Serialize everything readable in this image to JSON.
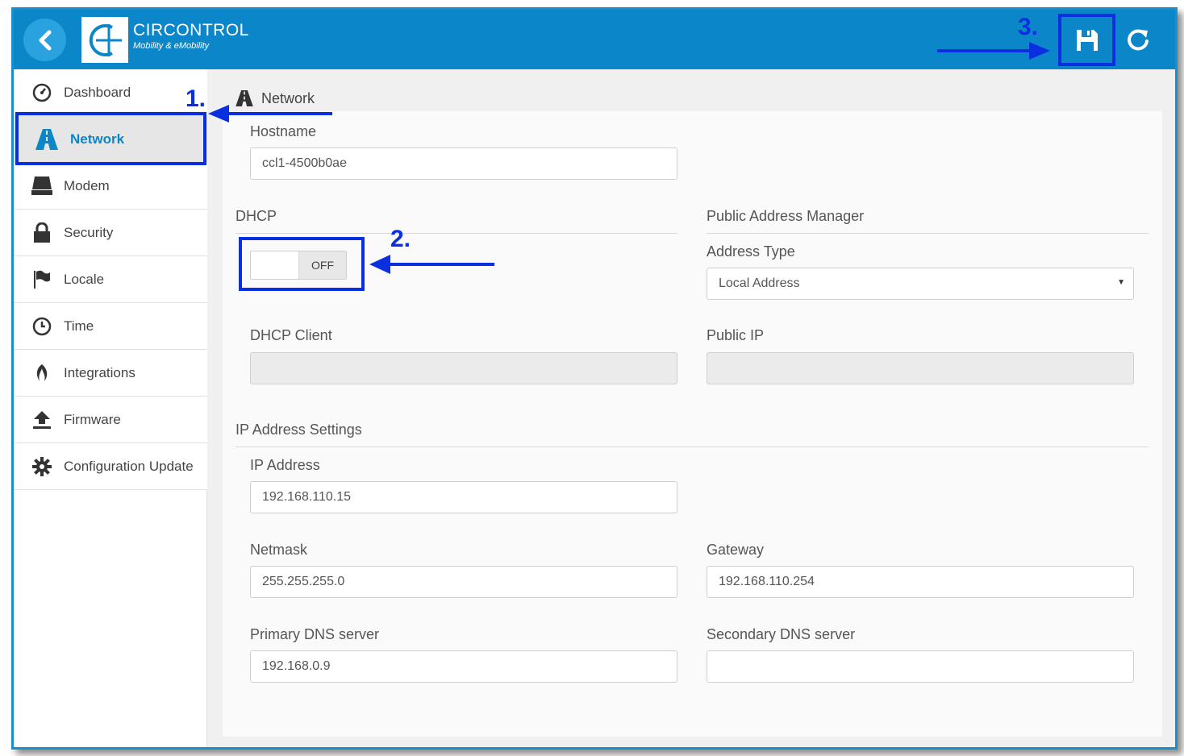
{
  "app": {
    "brand_name": "CIRCONTROL",
    "brand_tagline": "Mobility & eMobility"
  },
  "sidebar": {
    "items": [
      {
        "label": "Dashboard",
        "icon": "dashboard-icon"
      },
      {
        "label": "Network",
        "icon": "network-road-icon",
        "active": true
      },
      {
        "label": "Modem",
        "icon": "modem-icon"
      },
      {
        "label": "Security",
        "icon": "lock-icon"
      },
      {
        "label": "Locale",
        "icon": "flag-icon"
      },
      {
        "label": "Time",
        "icon": "clock-icon"
      },
      {
        "label": "Integrations",
        "icon": "integrations-icon"
      },
      {
        "label": "Firmware",
        "icon": "upload-icon"
      },
      {
        "label": "Configuration Update",
        "icon": "gear-icon"
      }
    ]
  },
  "main": {
    "title": "Network",
    "hostname_label": "Hostname",
    "hostname_value": "ccl1-4500b0ae",
    "dhcp_section": "DHCP",
    "dhcp_toggle_state": "OFF",
    "dhcp_client_label": "DHCP Client",
    "dhcp_client_value": "",
    "public_section": "Public Address Manager",
    "address_type_label": "Address Type",
    "address_type_value": "Local Address",
    "public_ip_label": "Public IP",
    "public_ip_value": "",
    "ip_section": "IP Address Settings",
    "ip_label": "IP Address",
    "ip_value": "192.168.110.15",
    "netmask_label": "Netmask",
    "netmask_value": "255.255.255.0",
    "gateway_label": "Gateway",
    "gateway_value": "192.168.110.254",
    "dns1_label": "Primary DNS server",
    "dns1_value": "192.168.0.9",
    "dns2_label": "Secondary DNS server",
    "dns2_value": ""
  },
  "annotations": {
    "step1": "1.",
    "step2": "2.",
    "step3": "3."
  },
  "colors": {
    "topbar": "#0b86c8",
    "annotation": "#0a2fe0",
    "active_text": "#0b86c8"
  }
}
